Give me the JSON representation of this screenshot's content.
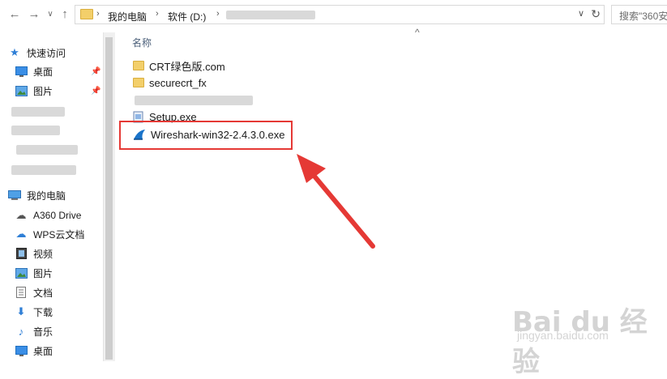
{
  "address_bar": {
    "crumbs": [
      "我的电脑",
      "软件 (D:)"
    ],
    "search_placeholder": "搜索\"360安"
  },
  "sidebar": {
    "quick_access": "快速访问",
    "pinned": [
      {
        "label": "桌面",
        "icon": "desktop-icon"
      },
      {
        "label": "图片",
        "icon": "pictures-icon"
      }
    ],
    "this_pc": "我的电脑",
    "pc_items": [
      {
        "label": "A360 Drive",
        "icon": "cloud-drive-icon"
      },
      {
        "label": "WPS云文档",
        "icon": "wps-cloud-icon"
      },
      {
        "label": "视频",
        "icon": "video-icon"
      },
      {
        "label": "图片",
        "icon": "pictures-icon"
      },
      {
        "label": "文档",
        "icon": "documents-icon"
      },
      {
        "label": "下载",
        "icon": "download-icon"
      },
      {
        "label": "音乐",
        "icon": "music-icon"
      },
      {
        "label": "桌面",
        "icon": "desktop-icon"
      }
    ]
  },
  "content": {
    "column_header": "名称",
    "files": [
      {
        "name": "CRT绿色版.com",
        "type": "folder"
      },
      {
        "name": "securecrt_fx",
        "type": "folder"
      },
      {
        "name": "Setup.exe",
        "type": "exe"
      },
      {
        "name": "Wireshark-win32-2.4.3.0.exe",
        "type": "wireshark"
      }
    ]
  },
  "watermark": {
    "text": "Bai du 经验",
    "sub": "jingyan.baidu.com"
  },
  "colors": {
    "annotation": "#e53935",
    "folder": "#f3cf6a",
    "header_text": "#4c607a"
  }
}
